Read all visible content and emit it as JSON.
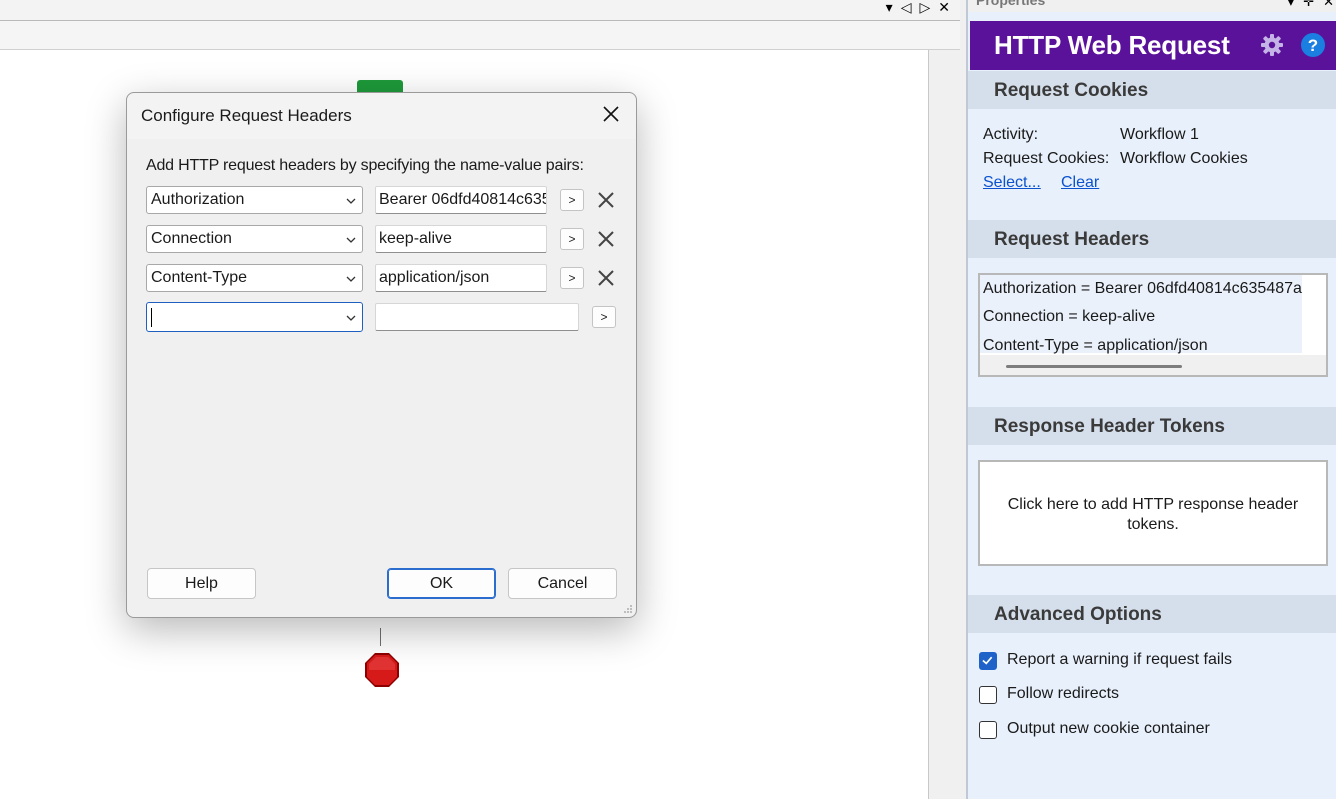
{
  "designer": {
    "tab_controls": [
      "▾",
      "◁",
      "▷",
      "✕"
    ]
  },
  "dialog": {
    "title": "Configure Request Headers",
    "description": "Add HTTP request headers by specifying the name-value pairs:",
    "rows": [
      {
        "name": "Authorization",
        "value": "Bearer 06dfd40814c635"
      },
      {
        "name": "Connection",
        "value": "keep-alive"
      },
      {
        "name": "Content-Type",
        "value": "application/json"
      },
      {
        "name": "",
        "value": ""
      }
    ],
    "arrow_label": ">",
    "help_label": "Help",
    "ok_label": "OK",
    "cancel_label": "Cancel"
  },
  "properties": {
    "caption": "Properties",
    "title": "HTTP Web Request",
    "request_cookies": {
      "heading": "Request Cookies",
      "activity_label": "Activity:",
      "activity_value": "Workflow 1",
      "cookies_label": "Request Cookies:",
      "cookies_value": "Workflow Cookies",
      "select_link": "Select...",
      "clear_link": "Clear"
    },
    "request_headers": {
      "heading": "Request Headers",
      "items": [
        "Authorization = Bearer 06dfd40814c635487a",
        "Connection = keep-alive",
        "Content-Type = application/json"
      ]
    },
    "response_tokens": {
      "heading": "Response Header Tokens",
      "prompt": "Click here to add HTTP response header tokens."
    },
    "advanced": {
      "heading": "Advanced Options",
      "options": [
        {
          "label": "Report a warning if request fails",
          "checked": true
        },
        {
          "label": "Follow redirects",
          "checked": false
        },
        {
          "label": "Output new cookie container",
          "checked": false
        }
      ]
    },
    "colors": {
      "header_bg": "#5b129b",
      "panel_bg": "#e8f0fb",
      "link": "#0b52cf",
      "checkbox_on": "#1f63c9"
    }
  }
}
